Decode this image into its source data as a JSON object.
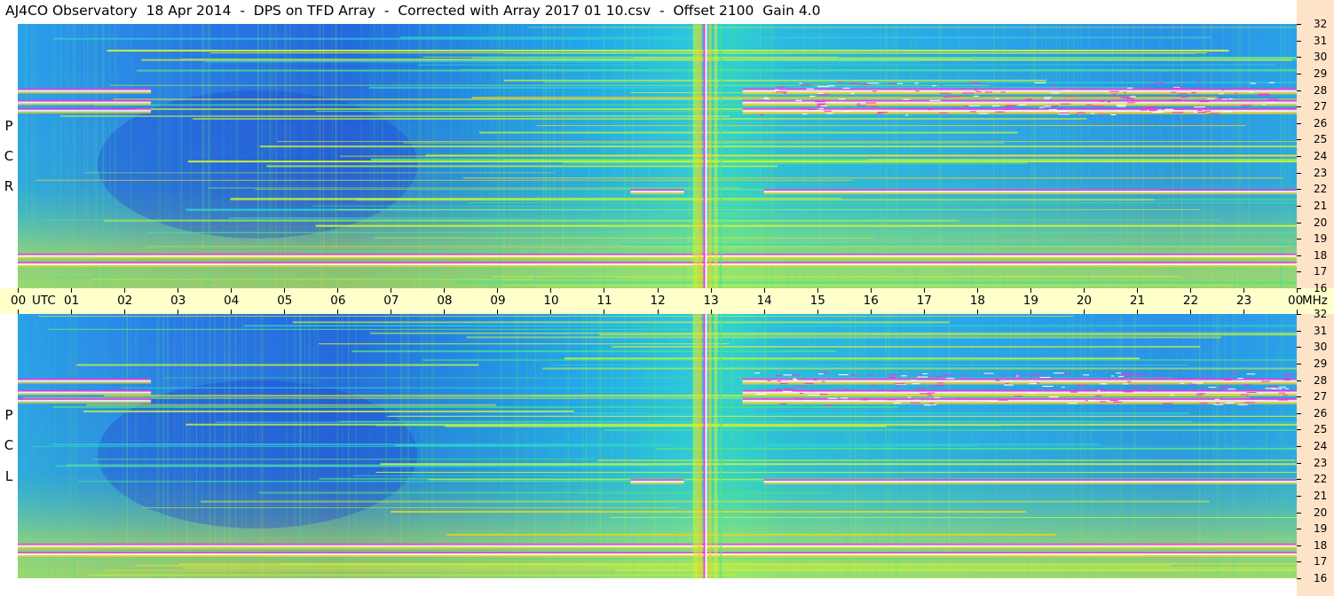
{
  "header": {
    "title": "AJ4CO Observatory  18 Apr 2014  -  DPS on TFD Array  -  Corrected with Array 2017 01 10.csv  -  Offset 2100  Gain 4.0"
  },
  "panels": [
    {
      "id": "rcp",
      "label_letters": [
        "R",
        "C",
        "P"
      ]
    },
    {
      "id": "lcp",
      "label_letters": [
        "L",
        "C",
        "P"
      ]
    }
  ],
  "axes": {
    "x_unit": "UTC",
    "y_unit": "MHz",
    "x_ticks": [
      "00",
      "01",
      "02",
      "03",
      "04",
      "05",
      "06",
      "07",
      "08",
      "09",
      "10",
      "11",
      "12",
      "13",
      "14",
      "15",
      "16",
      "17",
      "18",
      "19",
      "20",
      "21",
      "22",
      "23",
      "00"
    ],
    "y_ticks": [
      "32",
      "31",
      "30",
      "29",
      "28",
      "27",
      "26",
      "25",
      "24",
      "23",
      "22",
      "21",
      "20",
      "19",
      "18",
      "17",
      "16"
    ]
  },
  "chart_data": {
    "type": "heatmap",
    "title": "AJ4CO Observatory  18 Apr 2014  -  DPS on TFD Array  -  Corrected with Array 2017 01 10.csv  -  Offset 2100  Gain 4.0",
    "xlabel": "UTC",
    "ylabel": "MHz",
    "xlim": [
      0,
      24
    ],
    "ylim": [
      16,
      32
    ],
    "panels": [
      "RCP",
      "LCP"
    ],
    "colormap": [
      "#1f3fd8",
      "#2a7be6",
      "#22a8ec",
      "#2fd0d0",
      "#4ee28a",
      "#c9f23a",
      "#f4d020",
      "#ff66c0",
      "#ff2ce0",
      "#ffffff"
    ],
    "features": {
      "strong_interference_bands_mhz": [
        17.5,
        18.0,
        21.9,
        26.8,
        27.3,
        28.0
      ],
      "broadband_event_utc": 12.9,
      "low_intensity_region_utc": [
        1.5,
        7.5
      ]
    }
  }
}
